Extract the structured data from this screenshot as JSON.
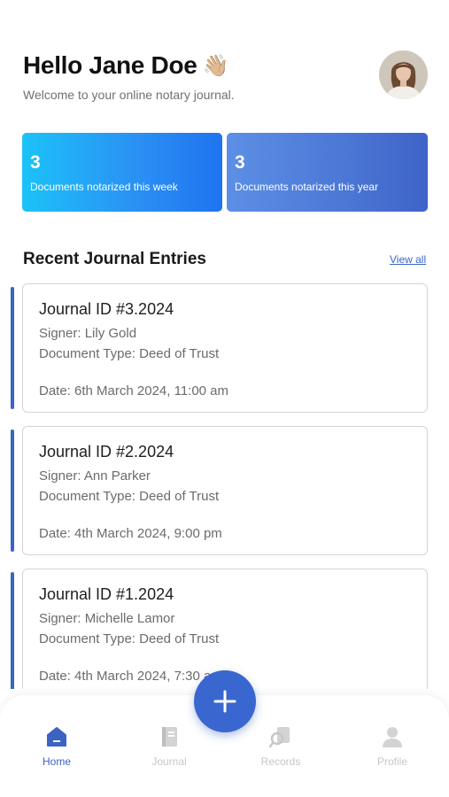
{
  "header": {
    "greeting": "Hello Jane Doe",
    "wave_emoji": "👋🏼",
    "subtitle": "Welcome to your online notary journal.",
    "avatar_icon": "user-avatar-photo"
  },
  "stats": [
    {
      "value": "3",
      "label": "Documents notarized this week"
    },
    {
      "value": "3",
      "label": "Documents notarized this year"
    }
  ],
  "recent": {
    "title": "Recent Journal Entries",
    "view_all": "View all"
  },
  "entries": [
    {
      "title": "Journal ID #3.2024",
      "signer": "Signer: Lily Gold",
      "doc_type": "Document Type: Deed of Trust",
      "date": "Date:  6th March 2024, 11:00 am"
    },
    {
      "title": "Journal ID #2.2024",
      "signer": "Signer: Ann Parker",
      "doc_type": "Document Type: Deed of Trust",
      "date": "Date:  4th March 2024, 9:00 pm"
    },
    {
      "title": "Journal ID #1.2024",
      "signer": "Signer: Michelle Lamor",
      "doc_type": "Document Type: Deed of Trust",
      "date": "Date:  4th March 2024, 7:30 am"
    }
  ],
  "nav": {
    "items": [
      {
        "label": "Home",
        "icon": "home-icon",
        "active": true
      },
      {
        "label": "Journal",
        "icon": "journal-icon",
        "active": false
      },
      {
        "label": "Records",
        "icon": "records-icon",
        "active": false
      },
      {
        "label": "Profile",
        "icon": "profile-icon",
        "active": false
      }
    ],
    "fab_icon": "plus-icon"
  },
  "colors": {
    "accent": "#3a63c4",
    "stat_week_gradient": [
      "#1cc2f8",
      "#1f74ef"
    ],
    "stat_year_gradient": [
      "#5c8fe6",
      "#3e63c9"
    ],
    "nav_inactive": "#c6c6c6"
  }
}
